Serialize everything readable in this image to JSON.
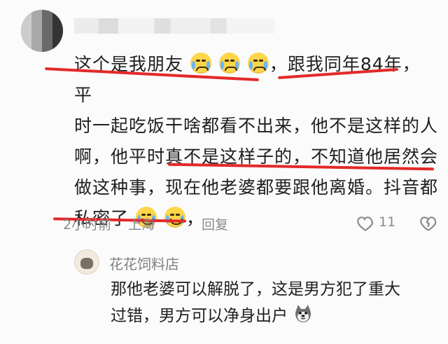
{
  "comment": {
    "line1_part1": "这个是我朋友",
    "line1_part2": "，跟我同年84年，平",
    "line2": "时一起吃饭干啥都看不出来，他不是这样的人",
    "line3": "啊，他平时真不是这样子的，不知道他居然会",
    "line4": "做这种事，现在他老婆都要跟他离婚。抖音都",
    "line5_part1": "私密了",
    "line5_part2": "，",
    "time": "2小时前",
    "location": "上海",
    "reply_label": "回复",
    "like_count": "11"
  },
  "reply": {
    "author": "花花饲料店",
    "text_line1": "那他老婆可以解脱了，这是男方犯了重大",
    "text_line2": "过错，男方可以净身出户"
  },
  "colors": {
    "accent_red": "#e32929",
    "meta_gray": "#8a8a8a"
  }
}
